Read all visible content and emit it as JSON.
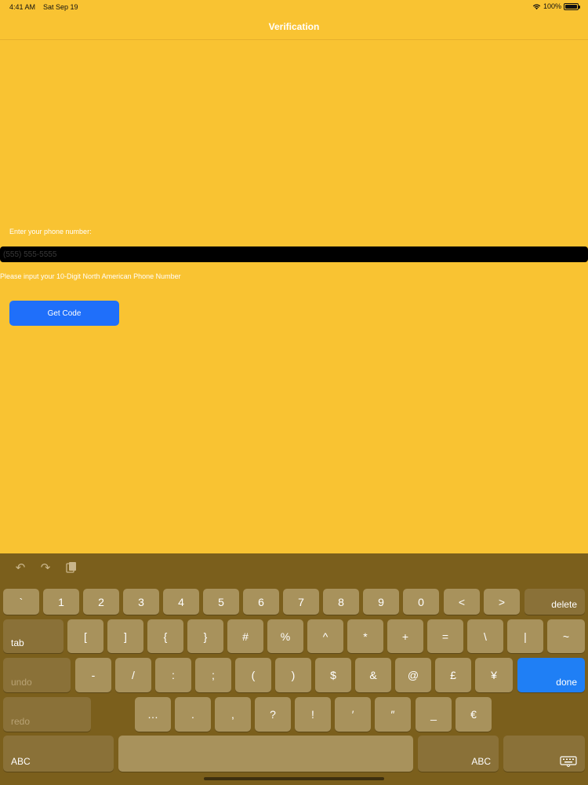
{
  "status": {
    "time": "4:41 AM",
    "date": "Sat Sep 19",
    "battery": "100%"
  },
  "nav": {
    "title": "Verification"
  },
  "form": {
    "label": "Enter your phone number:",
    "placeholder": "(555) 555-5555",
    "helper": "Please input your 10-Digit North American Phone Number",
    "button": "Get Code"
  },
  "keyboard": {
    "toolbar_icons": [
      "undo-icon",
      "redo-icon",
      "paste-icon"
    ],
    "row1": [
      "`",
      "1",
      "2",
      "3",
      "4",
      "5",
      "6",
      "7",
      "8",
      "9",
      "0",
      "<",
      ">"
    ],
    "row1_delete": "delete",
    "row2_tab": "tab",
    "row2": [
      "[",
      "]",
      "{",
      "}",
      "#",
      "%",
      "^",
      "*",
      "+",
      "=",
      "\\",
      "|",
      "~"
    ],
    "row3_undo": "undo",
    "row3": [
      "-",
      "/",
      ":",
      ";",
      "(",
      ")",
      "$",
      "&",
      "@",
      "£",
      "¥"
    ],
    "row3_done": "done",
    "row4_redo": "redo",
    "row4": [
      "…",
      ".",
      ",",
      "?",
      "!",
      "′",
      "″",
      "_",
      "€"
    ],
    "row5_abc_left": "ABC",
    "row5_abc_right": "ABC"
  }
}
